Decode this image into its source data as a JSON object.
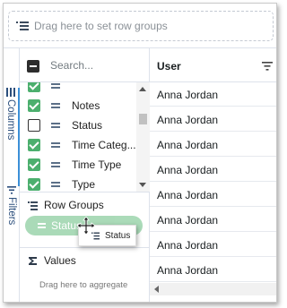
{
  "row_group_bar": {
    "placeholder": "Drag here to set row groups"
  },
  "side_bar": {
    "tabs": [
      {
        "label": "Columns"
      },
      {
        "label": "Filters"
      }
    ]
  },
  "column_panel": {
    "search_placeholder": "Search...",
    "columns": [
      {
        "label": "Notes",
        "checked": true
      },
      {
        "label": "Status",
        "checked": false
      },
      {
        "label": "Time Categ...",
        "checked": true
      },
      {
        "label": "Time Type",
        "checked": true
      },
      {
        "label": "Type",
        "checked": true
      }
    ],
    "row_groups": {
      "title": "Row Groups",
      "chip_label": "Status"
    },
    "values": {
      "title": "Values",
      "hint": "Drag here to aggregate"
    }
  },
  "grid": {
    "header": "User",
    "rows": [
      "Anna Jordan",
      "Anna Jordan",
      "Anna Jordan",
      "Anna Jordan",
      "Anna Jordan",
      "Anna Jordan",
      "Anna Jordan",
      "Anna Jordan",
      "Anna Jordan"
    ]
  },
  "drag_ghost": {
    "label": "Status"
  },
  "colors": {
    "checked": "#4caf6e",
    "chip": "#a6d9b5",
    "active_tab": "#3c8fd8"
  }
}
